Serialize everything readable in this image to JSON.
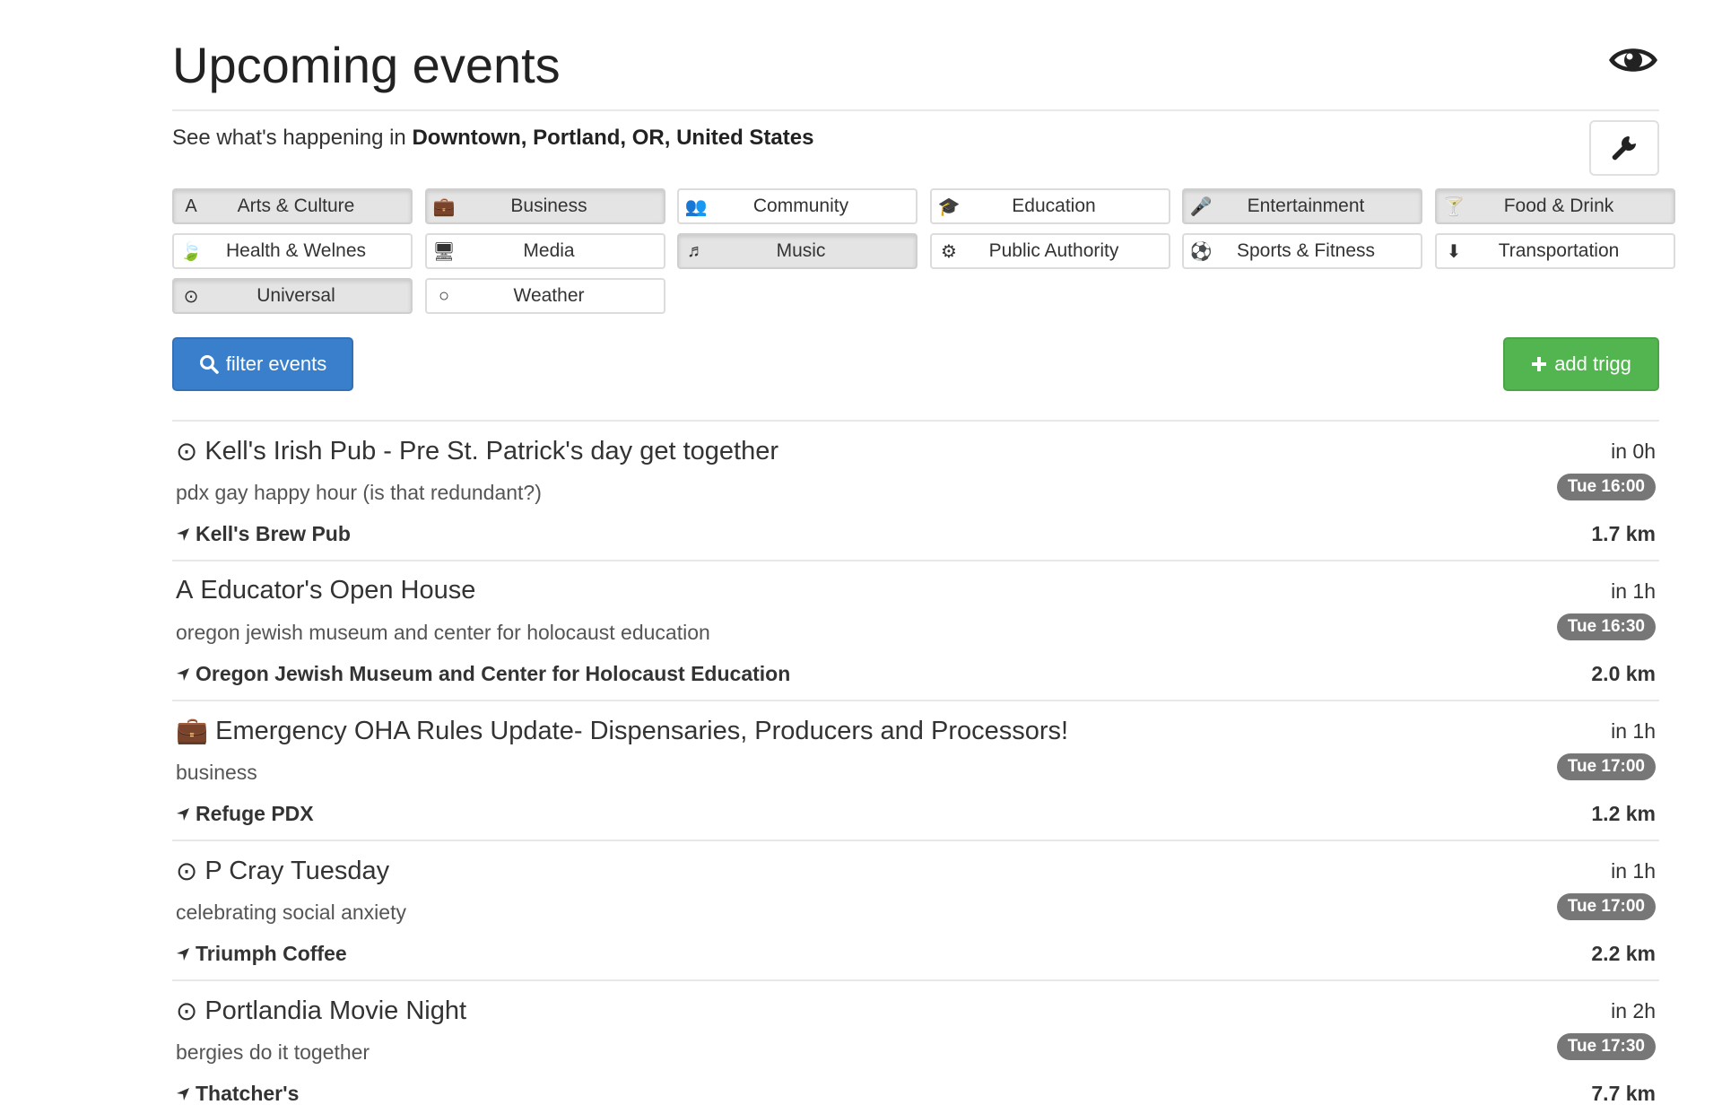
{
  "header": {
    "title": "Upcoming events",
    "eye_icon": "eye-icon"
  },
  "location": {
    "prefix": "See what's happening in ",
    "place": "Downtown, Portland, OR, United States"
  },
  "settings_icon": "wrench-icon",
  "categories": [
    {
      "label": "Arts & Culture",
      "icon": "A",
      "active": true
    },
    {
      "label": "Business",
      "icon": "💼",
      "active": true
    },
    {
      "label": "Community",
      "icon": "👥",
      "active": false
    },
    {
      "label": "Education",
      "icon": "🎓",
      "active": false
    },
    {
      "label": "Entertainment",
      "icon": "🎤",
      "active": true
    },
    {
      "label": "Food & Drink",
      "icon": "🍸",
      "active": true
    },
    {
      "label": "Health & Welnes",
      "icon": "🍃",
      "active": false
    },
    {
      "label": "Media",
      "icon": "🖥",
      "active": false
    },
    {
      "label": "Music",
      "icon": "♬",
      "active": true
    },
    {
      "label": "Public Authority",
      "icon": "⚙",
      "active": false
    },
    {
      "label": "Sports & Fitness",
      "icon": "⚽",
      "active": false
    },
    {
      "label": "Transportation",
      "icon": "⬇",
      "active": false
    },
    {
      "label": "Universal",
      "icon": "⊙",
      "active": true
    },
    {
      "label": "Weather",
      "icon": "○",
      "active": false
    }
  ],
  "buttons": {
    "filter_label": "filter events",
    "add_label": "add trigg"
  },
  "events": [
    {
      "icon": "⊙",
      "title": "Kell's Irish Pub - Pre St. Patrick's day get together",
      "subtitle": "pdx gay happy hour (is that redundant?)",
      "venue": "Kell's Brew Pub",
      "relative": "in 0h",
      "time": "Tue 16:00",
      "distance": "1.7 km"
    },
    {
      "icon": "A",
      "title": "Educator's Open House",
      "subtitle": "oregon jewish museum and center for holocaust education",
      "venue": "Oregon Jewish Museum and Center for Holocaust Education",
      "relative": "in 1h",
      "time": "Tue 16:30",
      "distance": "2.0 km"
    },
    {
      "icon": "💼",
      "title": "Emergency OHA Rules Update- Dispensaries, Producers and Processors!",
      "subtitle": "business",
      "venue": "Refuge PDX",
      "relative": "in 1h",
      "time": "Tue 17:00",
      "distance": "1.2 km"
    },
    {
      "icon": "⊙",
      "title": "P Cray Tuesday",
      "subtitle": "celebrating social anxiety",
      "venue": "Triumph Coffee",
      "relative": "in 1h",
      "time": "Tue 17:00",
      "distance": "2.2 km"
    },
    {
      "icon": "⊙",
      "title": "Portlandia Movie Night",
      "subtitle": "bergies do it together",
      "venue": "Thatcher's",
      "relative": "in 2h",
      "time": "Tue 17:30",
      "distance": "7.7 km"
    }
  ]
}
